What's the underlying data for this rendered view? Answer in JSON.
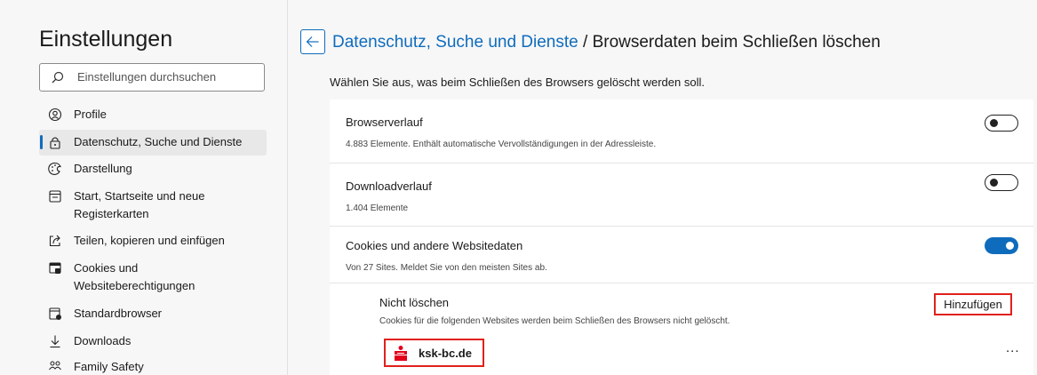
{
  "sidebar": {
    "title": "Einstellungen",
    "search_placeholder": "Einstellungen durchsuchen",
    "items": [
      {
        "label": "Profile",
        "icon": "profile-icon"
      },
      {
        "label": "Datenschutz, Suche und Dienste",
        "icon": "lock-icon",
        "active": true
      },
      {
        "label": "Darstellung",
        "icon": "appearance-icon"
      },
      {
        "label": "Start, Startseite und neue Registerkarten",
        "icon": "start-page-icon"
      },
      {
        "label": "Teilen, kopieren und einfügen",
        "icon": "share-icon"
      },
      {
        "label": "Cookies und Websiteberechtigungen",
        "icon": "cookies-permissions-icon"
      },
      {
        "label": "Standardbrowser",
        "icon": "default-browser-icon"
      },
      {
        "label": "Downloads",
        "icon": "download-icon"
      },
      {
        "label": "Family Safety",
        "icon": "family-icon"
      }
    ]
  },
  "header": {
    "breadcrumb_link": "Datenschutz, Suche und Dienste",
    "separator": "/",
    "current": "Browserdaten beim Schließen löschen"
  },
  "description": "Wählen Sie aus, was beim Schließen des Browsers gelöscht werden soll.",
  "rows": [
    {
      "title": "Browserverlauf",
      "subtitle": "4.883 Elemente. Enthält automatische Vervollständigungen in der Adressleiste.",
      "enabled": false
    },
    {
      "title": "Downloadverlauf",
      "subtitle": "1.404 Elemente",
      "enabled": false
    },
    {
      "title": "Cookies und andere Websitedaten",
      "subtitle": "Von 27 Sites. Meldet Sie von den meisten Sites ab.",
      "enabled": true
    }
  ],
  "exceptions": {
    "title": "Nicht löschen",
    "subtitle": "Cookies für die folgenden Websites werden beim Schließen des Browsers nicht gelöscht.",
    "add_label": "Hinzufügen",
    "sites": [
      {
        "name": "ksk-bc.de",
        "more_label": "..."
      }
    ]
  },
  "colors": {
    "accent": "#0f6cbd",
    "highlight": "#e0211b",
    "site_logo": "#e2001a"
  }
}
